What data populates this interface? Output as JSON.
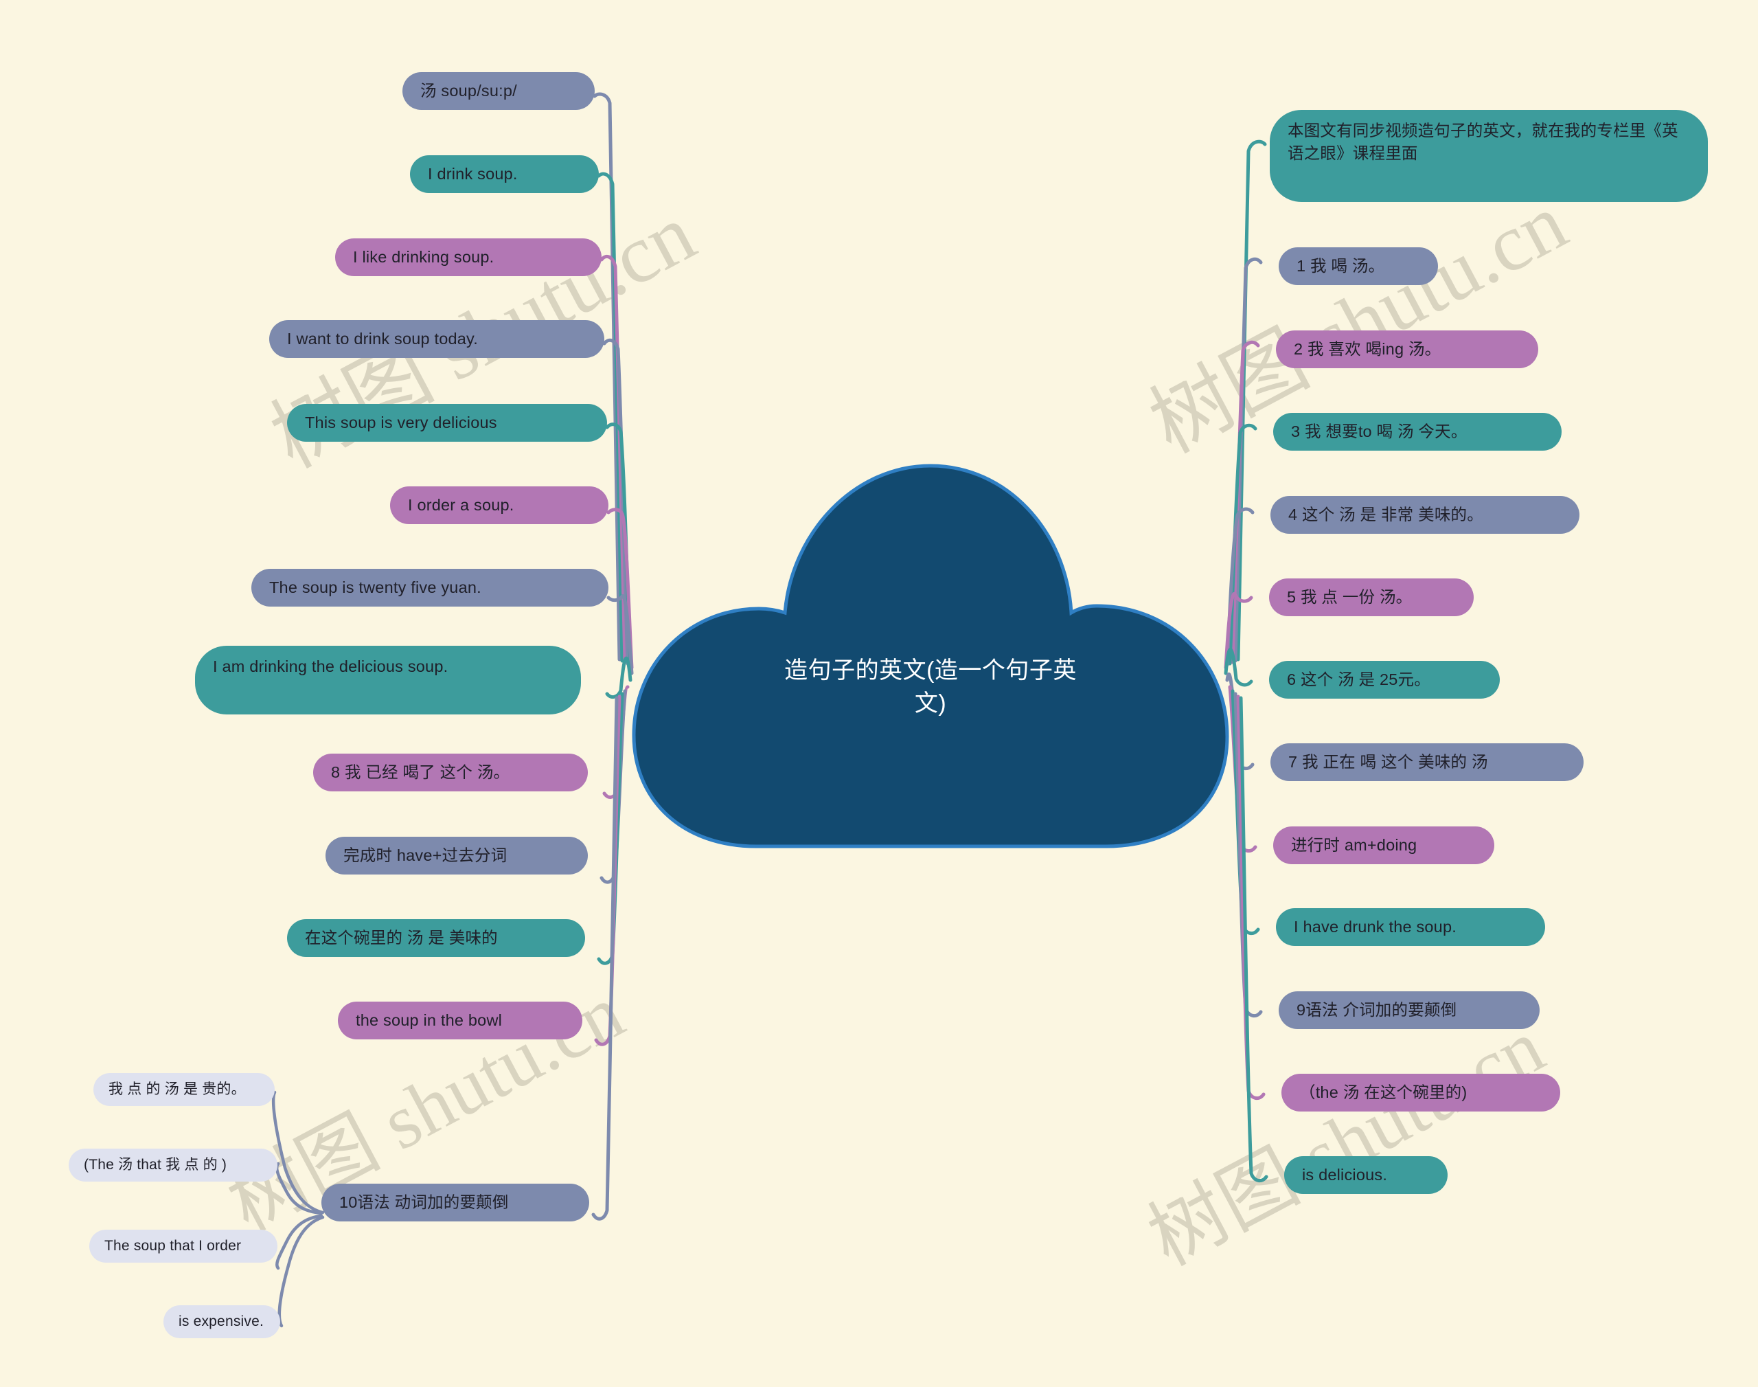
{
  "meta": {
    "background_color": "#fbf6e1",
    "root_color": "#124a70",
    "palette": {
      "slate": "#7d8aad",
      "teal": "#3d9c9c",
      "purple": "#b277b4",
      "pale": "#dfe2ef"
    },
    "watermark_text": "树图 shutu.cn"
  },
  "root": {
    "title": "造句子的英文(造一个句子英文)",
    "shape": "cloud"
  },
  "left_branch": {
    "nodes": [
      {
        "id": "l1",
        "label": "汤 soup/su:p/",
        "color": "slate"
      },
      {
        "id": "l2",
        "label": "I drink soup.",
        "color": "teal"
      },
      {
        "id": "l3",
        "label": "I like drinking soup.",
        "color": "purple"
      },
      {
        "id": "l4",
        "label": "I want to drink soup today.",
        "color": "slate"
      },
      {
        "id": "l5",
        "label": "This soup is very delicious",
        "color": "teal"
      },
      {
        "id": "l6",
        "label": "I order a soup.",
        "color": "purple"
      },
      {
        "id": "l7",
        "label": "The soup is twenty five yuan.",
        "color": "slate"
      },
      {
        "id": "l8",
        "label": " I am drinking the delicious soup.",
        "color": "teal"
      },
      {
        "id": "l9",
        "label": "8 我 已经 喝了 这个 汤。",
        "color": "purple"
      },
      {
        "id": "l10",
        "label": "完成时 have+过去分词",
        "color": "slate"
      },
      {
        "id": "l11",
        "label": "在这个碗里的 汤 是 美味的",
        "color": "teal"
      },
      {
        "id": "l12",
        "label": "the soup in the bowl",
        "color": "purple"
      },
      {
        "id": "l13",
        "label": "10语法 动词加的要颠倒",
        "color": "slate"
      }
    ],
    "sub_nodes": [
      {
        "id": "s1",
        "label": "我 点 的 汤 是 贵的。",
        "color": "pale",
        "parent": "l13"
      },
      {
        "id": "s2",
        "label": "(The 汤 that 我 点 的 )",
        "color": "pale",
        "parent": "l13"
      },
      {
        "id": "s3",
        "label": "The soup that I order",
        "color": "pale",
        "parent": "l13"
      },
      {
        "id": "s4",
        "label": "is expensive.",
        "color": "pale",
        "parent": "l13"
      }
    ]
  },
  "right_branch": {
    "nodes": [
      {
        "id": "r1",
        "label": " 本图文有同步视频造句子的英文，就在我的专栏里《英语之眼》课程里面",
        "color": "teal"
      },
      {
        "id": "r2",
        "label": "1 我 喝 汤。",
        "color": "slate"
      },
      {
        "id": "r3",
        "label": "2 我 喜欢 喝ing 汤。",
        "color": "purple"
      },
      {
        "id": "r4",
        "label": "3 我 想要to 喝 汤 今天。",
        "color": "teal"
      },
      {
        "id": "r5",
        "label": "4 这个 汤 是 非常 美味的。",
        "color": "slate"
      },
      {
        "id": "r6",
        "label": "5 我 点 一份 汤。",
        "color": "purple"
      },
      {
        "id": "r7",
        "label": "6 这个 汤 是 25元。",
        "color": "teal"
      },
      {
        "id": "r8",
        "label": "7 我 正在 喝 这个 美味的 汤",
        "color": "slate"
      },
      {
        "id": "r9",
        "label": "进行时 am+doing",
        "color": "purple"
      },
      {
        "id": "r10",
        "label": "I have drunk the soup.",
        "color": "teal"
      },
      {
        "id": "r11",
        "label": "9语法 介词加的要颠倒",
        "color": "slate"
      },
      {
        "id": "r12",
        "label": "（the 汤 在这个碗里的)",
        "color": "purple"
      },
      {
        "id": "r13",
        "label": "is delicious.",
        "color": "teal"
      }
    ]
  }
}
